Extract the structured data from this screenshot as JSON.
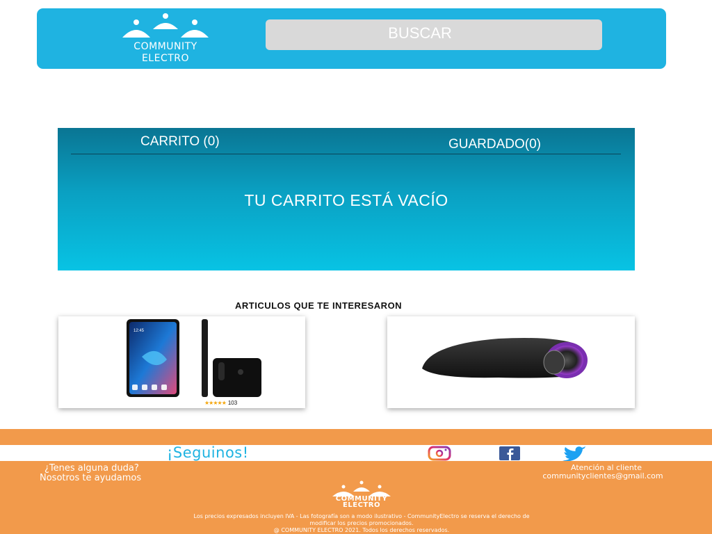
{
  "header": {
    "logo": {
      "line1": "COMMUNITY",
      "line2": "ELECTRO"
    },
    "search": {
      "label": "BUSCAR"
    }
  },
  "cart": {
    "tab_cart": "CARRITO (0)",
    "tab_saved": "GUARDADO(0)",
    "empty_message": "TU CARRITO ESTÁ VACÍO"
  },
  "recommended": {
    "title": "ARTICULOS QUE TE INTERESARON",
    "items": [
      {
        "image": "smartphone-image",
        "stars": "★★★★★",
        "rating_count": "103"
      },
      {
        "image": "bluetooth-speaker-image"
      }
    ]
  },
  "footer": {
    "follow": "¡Seguinos!",
    "social_icons": [
      "instagram-icon",
      "facebook-icon",
      "twitter-icon"
    ],
    "help_line1": "¿Tenes alguna duda?",
    "help_line2": "Nosotros te ayudamos",
    "contact_label": "Atención al cliente",
    "contact_email": "communityclientes@gmail.com",
    "logo": {
      "line1": "COMMUNITY",
      "line2": "ELECTRO"
    },
    "legal_line1": "Los precios expresados incluyen IVA - Las fotografía son a modo ilustrativo - CommunityElectro se reserva el derecho de",
    "legal_line2": "modificar los precios promocionados.",
    "legal_line3": "@ COMMUNITY ELECTRO 2021. Todos los derechos reservados."
  },
  "colors": {
    "header_bg": "#1fb3e1",
    "footer_bg": "#f29a4b",
    "search_bg": "#d9d9d9",
    "cart_top": "#0a7593",
    "cart_bottom": "#08c3e4"
  }
}
